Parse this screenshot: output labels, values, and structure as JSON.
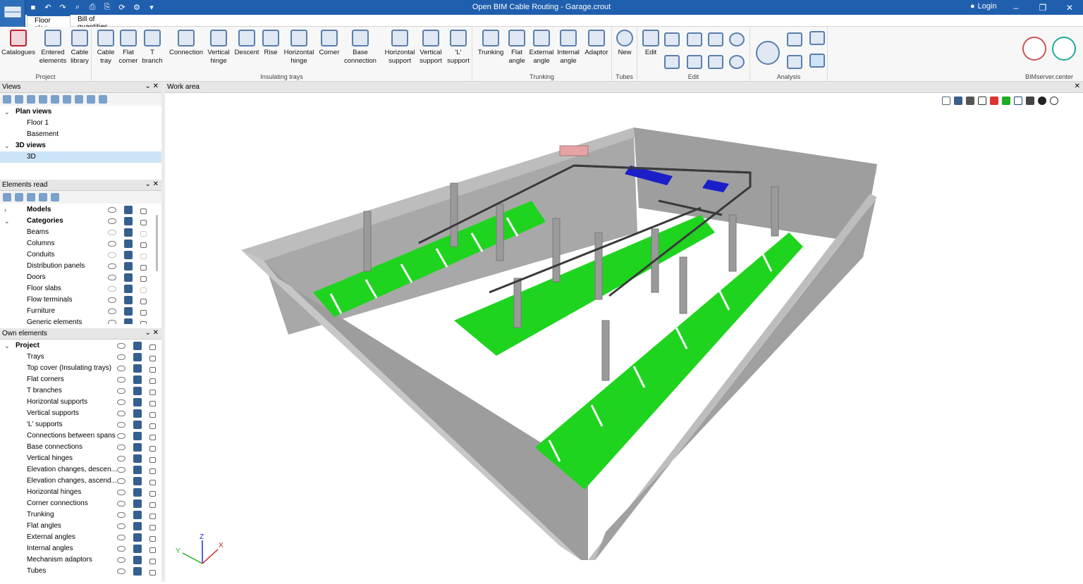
{
  "window": {
    "title": "Open BIM Cable Routing - Garage.crout",
    "login_label": "Login",
    "buttons": [
      "–",
      "❐",
      "✕"
    ]
  },
  "quick_access": [
    "save-icon",
    "undo-icon",
    "redo-icon",
    "search-icon",
    "print-icon",
    "print-preview-icon",
    "refresh-icon",
    "settings-icon",
    "dropdown-icon"
  ],
  "tabs": [
    {
      "label": "Floor plan",
      "active": true
    },
    {
      "label": "Bill of quantities",
      "active": false
    }
  ],
  "ribbon": {
    "groups": [
      {
        "label": "Project",
        "buttons": [
          "Catalogues",
          "Entered\nelements",
          "Cable\nlibrary"
        ]
      },
      {
        "label": "Insulating trays",
        "buttons": [
          "Cable\ntray",
          "Flat\ncorner",
          "T\nbranch",
          "Connection",
          "Vertical\nhinge",
          "Descent",
          "Rise",
          "Horizontal\nhinge",
          "Corner",
          "Base\nconnection",
          "Horizontal\nsupport",
          "Vertical\nsupport",
          "'L'\nsupport"
        ]
      },
      {
        "label": "Trunking",
        "buttons": [
          "Trunking",
          "Flat\nangle",
          "External\nangle",
          "Internal\nangle",
          "Adaptor"
        ]
      },
      {
        "label": "Tubes",
        "buttons": [
          "New"
        ]
      },
      {
        "label": "Edit",
        "buttons": [
          "Edit"
        ]
      },
      {
        "label": "Analysis",
        "buttons": []
      },
      {
        "label": "BIMserver.center",
        "buttons": []
      }
    ]
  },
  "views_panel": {
    "title": "Views",
    "items": [
      {
        "label": "Plan views",
        "level": 0,
        "expanded": true
      },
      {
        "label": "Floor 1",
        "level": 1
      },
      {
        "label": "Basement",
        "level": 1
      },
      {
        "label": "3D views",
        "level": 0,
        "expanded": true
      },
      {
        "label": "3D",
        "level": 1,
        "selected": true
      }
    ]
  },
  "elements_read_panel": {
    "title": "Elements read",
    "items": [
      {
        "label": "Models",
        "level": 0,
        "expanded": false,
        "visible": true
      },
      {
        "label": "Categories",
        "level": 0,
        "expanded": true,
        "visible": true
      },
      {
        "label": "Beams",
        "level": 1,
        "visible": false
      },
      {
        "label": "Columns",
        "level": 1,
        "visible": true
      },
      {
        "label": "Conduits",
        "level": 1,
        "visible": false
      },
      {
        "label": "Distribution panels",
        "level": 1,
        "visible": true
      },
      {
        "label": "Doors",
        "level": 1,
        "visible": true
      },
      {
        "label": "Floor slabs",
        "level": 1,
        "visible": false
      },
      {
        "label": "Flow terminals",
        "level": 1,
        "visible": true
      },
      {
        "label": "Furniture",
        "level": 1,
        "visible": true
      },
      {
        "label": "Generic elements",
        "level": 1,
        "visible": true
      }
    ]
  },
  "own_elements_panel": {
    "title": "Own elements",
    "items": [
      {
        "label": "Project",
        "level": 0,
        "expanded": true
      },
      {
        "label": "Trays",
        "level": 1
      },
      {
        "label": "Top cover (Insulating trays)",
        "level": 1
      },
      {
        "label": "Flat corners",
        "level": 1
      },
      {
        "label": "T branches",
        "level": 1
      },
      {
        "label": "Horizontal supports",
        "level": 1
      },
      {
        "label": "Vertical supports",
        "level": 1
      },
      {
        "label": "'L' supports",
        "level": 1
      },
      {
        "label": "Connections between spans",
        "level": 1
      },
      {
        "label": "Base connections",
        "level": 1
      },
      {
        "label": "Vertical hinges",
        "level": 1
      },
      {
        "label": "Elevation changes, descen...",
        "level": 1
      },
      {
        "label": "Elevation changes, ascend...",
        "level": 1
      },
      {
        "label": "Horizontal hinges",
        "level": 1
      },
      {
        "label": "Corner connections",
        "level": 1
      },
      {
        "label": "Trunking",
        "level": 1
      },
      {
        "label": "Flat angles",
        "level": 1
      },
      {
        "label": "External angles",
        "level": 1
      },
      {
        "label": "Internal angles",
        "level": 1
      },
      {
        "label": "Mechanism adaptors",
        "level": 1
      },
      {
        "label": "Tubes",
        "level": 1
      }
    ]
  },
  "work_area": {
    "title": "Work area",
    "axes": {
      "x": "X",
      "y": "Y",
      "z": "Z"
    }
  },
  "colors": {
    "titlebar": "#1f5fae",
    "parking_green": "#1fd41f",
    "parking_blue": "#1a1fc8",
    "wall_grey": "#a6a6a6",
    "selection": "#cce4f7"
  }
}
